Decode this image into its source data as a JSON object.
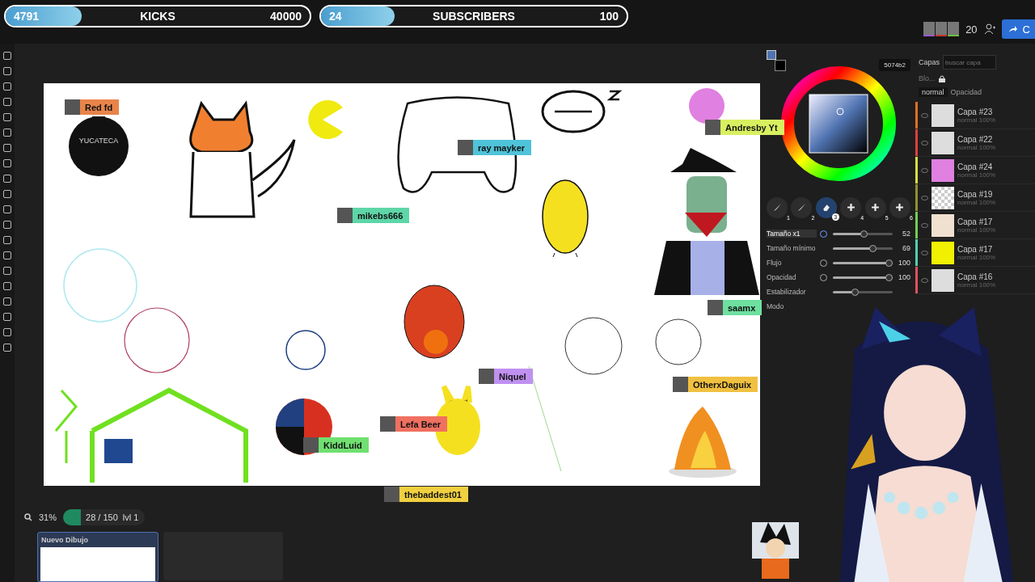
{
  "goals": [
    {
      "count": "4791",
      "label": "KICKS",
      "target": "40000",
      "level": 0.25
    },
    {
      "count": "24",
      "label": "SUBSCRIBERS",
      "target": "100",
      "level": 0.24
    }
  ],
  "collaborators": {
    "count": "20",
    "avatars": [
      {
        "color": "#9b59d0"
      },
      {
        "color": "#c0392b"
      },
      {
        "color": "#6abf40"
      }
    ],
    "share_label": "C"
  },
  "canvas": {
    "bomb_label": "YUCATECA",
    "cursors": [
      {
        "name": "Red fd",
        "color": "#e8844a"
      },
      {
        "name": "ray mayker",
        "color": "#4fc3d9"
      },
      {
        "name": "mikebs666",
        "color": "#5ed6a8"
      },
      {
        "name": "Andresby Yt",
        "color": "#d8f060"
      },
      {
        "name": "saamx",
        "color": "#6ee0a0"
      },
      {
        "name": "Niquel",
        "color": "#c090f0"
      },
      {
        "name": "OtherxDaguix",
        "color": "#f0c040"
      },
      {
        "name": "Lefa Beer",
        "color": "#f07060"
      },
      {
        "name": "KiddLuid",
        "color": "#70e070"
      },
      {
        "name": "thebaddest01",
        "color": "#f0d040"
      }
    ]
  },
  "status": {
    "zoom": "31%",
    "progress": "28 / 150",
    "lvl": "lvl 1"
  },
  "drawings": [
    {
      "title": "Nuevo Dibujo",
      "selected": true
    }
  ],
  "color_panel": {
    "hex": "5074b2",
    "foreground": {
      "color": "#5074b2"
    },
    "background": {
      "color": "#000000"
    },
    "slots": [
      {
        "kind": "brush",
        "number": "1",
        "selected": false
      },
      {
        "kind": "brush",
        "number": "2",
        "selected": false
      },
      {
        "kind": "eraser",
        "number": "3",
        "selected": true
      },
      {
        "kind": "add",
        "number": "4",
        "selected": false
      },
      {
        "kind": "add",
        "number": "5",
        "selected": false
      },
      {
        "kind": "add",
        "number": "6",
        "selected": false
      }
    ],
    "sliders": [
      {
        "label": "Tamaño x1",
        "reading": "52",
        "level": 0.52,
        "pressure_on": true
      },
      {
        "label": "Tamaño mínimo",
        "reading": "69",
        "level": 0.69
      },
      {
        "label": "Flujo",
        "reading": "100",
        "level": 1,
        "pressure_on": false
      },
      {
        "label": "Opacidad",
        "reading": "100",
        "level": 1,
        "pressure_on": false
      },
      {
        "label": "Estabilizador",
        "level": 0.35
      }
    ],
    "mode_label": "Modo"
  },
  "layers": {
    "title": "Capas",
    "search": {
      "placeholder": "buscar capa"
    },
    "lock_label": "Blo...",
    "blend": "normal",
    "opacity_label": "Opacidad",
    "items": [
      {
        "name": "Capa #23",
        "info": "normal 100%",
        "color": "#e07020",
        "kind": "sketch"
      },
      {
        "name": "Capa #22",
        "info": "normal 100%",
        "color": "#e04040",
        "kind": "sketch"
      },
      {
        "name": "Capa #24",
        "info": "normal 100%",
        "color": "#d8e040",
        "kind": "ball"
      },
      {
        "name": "Capa #19",
        "info": "normal 100%",
        "color": "#909030",
        "kind": "empty"
      },
      {
        "name": "Capa #17",
        "info": "normal 100%",
        "color": "#70d050",
        "kind": "fox"
      },
      {
        "name": "Capa #17",
        "info": "normal 100%",
        "color": "#50d0b0",
        "kind": "pacman"
      },
      {
        "name": "Capa #16",
        "info": "normal 100%",
        "color": "#e05060",
        "kind": "sketch"
      }
    ]
  }
}
